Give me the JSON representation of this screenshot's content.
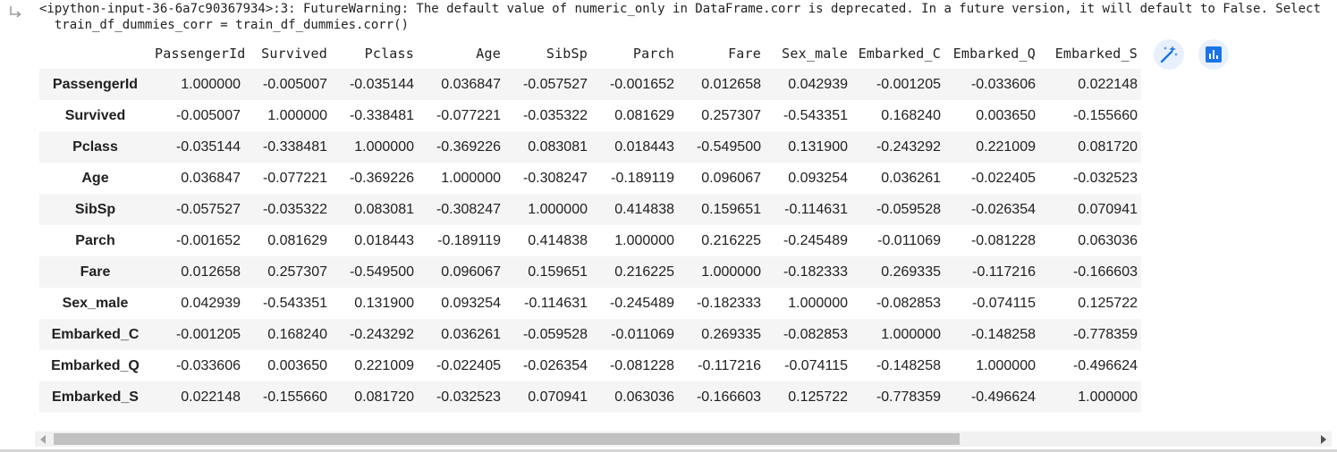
{
  "output": {
    "warning_line1": "<ipython-input-36-6a7c90367934>:3: FutureWarning: The default value of numeric_only in DataFrame.corr is deprecated. In a future version, it will default to False. Select only valid",
    "warning_line2": "  train_df_dummies_corr = train_df_dummies.corr()"
  },
  "table": {
    "columns": [
      "PassengerId",
      "Survived",
      "Pclass",
      "Age",
      "SibSp",
      "Parch",
      "Fare",
      "Sex_male",
      "Embarked_C",
      "Embarked_Q",
      "Embarked_S"
    ],
    "rows": [
      {
        "index": "PassengerId",
        "values": [
          "1.000000",
          "-0.005007",
          "-0.035144",
          "0.036847",
          "-0.057527",
          "-0.001652",
          "0.012658",
          "0.042939",
          "-0.001205",
          "-0.033606",
          "0.022148"
        ]
      },
      {
        "index": "Survived",
        "values": [
          "-0.005007",
          "1.000000",
          "-0.338481",
          "-0.077221",
          "-0.035322",
          "0.081629",
          "0.257307",
          "-0.543351",
          "0.168240",
          "0.003650",
          "-0.155660"
        ]
      },
      {
        "index": "Pclass",
        "values": [
          "-0.035144",
          "-0.338481",
          "1.000000",
          "-0.369226",
          "0.083081",
          "0.018443",
          "-0.549500",
          "0.131900",
          "-0.243292",
          "0.221009",
          "0.081720"
        ]
      },
      {
        "index": "Age",
        "values": [
          "0.036847",
          "-0.077221",
          "-0.369226",
          "1.000000",
          "-0.308247",
          "-0.189119",
          "0.096067",
          "0.093254",
          "0.036261",
          "-0.022405",
          "-0.032523"
        ]
      },
      {
        "index": "SibSp",
        "values": [
          "-0.057527",
          "-0.035322",
          "0.083081",
          "-0.308247",
          "1.000000",
          "0.414838",
          "0.159651",
          "-0.114631",
          "-0.059528",
          "-0.026354",
          "0.070941"
        ]
      },
      {
        "index": "Parch",
        "values": [
          "-0.001652",
          "0.081629",
          "0.018443",
          "-0.189119",
          "0.414838",
          "1.000000",
          "0.216225",
          "-0.245489",
          "-0.011069",
          "-0.081228",
          "0.063036"
        ]
      },
      {
        "index": "Fare",
        "values": [
          "0.012658",
          "0.257307",
          "-0.549500",
          "0.096067",
          "0.159651",
          "0.216225",
          "1.000000",
          "-0.182333",
          "0.269335",
          "-0.117216",
          "-0.166603"
        ]
      },
      {
        "index": "Sex_male",
        "values": [
          "0.042939",
          "-0.543351",
          "0.131900",
          "0.093254",
          "-0.114631",
          "-0.245489",
          "-0.182333",
          "1.000000",
          "-0.082853",
          "-0.074115",
          "0.125722"
        ]
      },
      {
        "index": "Embarked_C",
        "values": [
          "-0.001205",
          "0.168240",
          "-0.243292",
          "0.036261",
          "-0.059528",
          "-0.011069",
          "0.269335",
          "-0.082853",
          "1.000000",
          "-0.148258",
          "-0.778359"
        ]
      },
      {
        "index": "Embarked_Q",
        "values": [
          "-0.033606",
          "0.003650",
          "0.221009",
          "-0.022405",
          "-0.026354",
          "-0.081228",
          "-0.117216",
          "-0.074115",
          "-0.148258",
          "1.000000",
          "-0.496624"
        ]
      },
      {
        "index": "Embarked_S",
        "values": [
          "0.022148",
          "-0.155660",
          "0.081720",
          "-0.032523",
          "0.070941",
          "0.063036",
          "-0.166603",
          "0.125722",
          "-0.778359",
          "-0.496624",
          "1.000000"
        ]
      }
    ]
  },
  "icons": {
    "output": "output-arrow-icon",
    "magic": "magic-wand-icon",
    "chart": "bar-chart-icon"
  },
  "colors": {
    "accent": "#1a73e8",
    "button_bg": "#e8f0fe",
    "row_stripe": "#f5f5f5"
  }
}
